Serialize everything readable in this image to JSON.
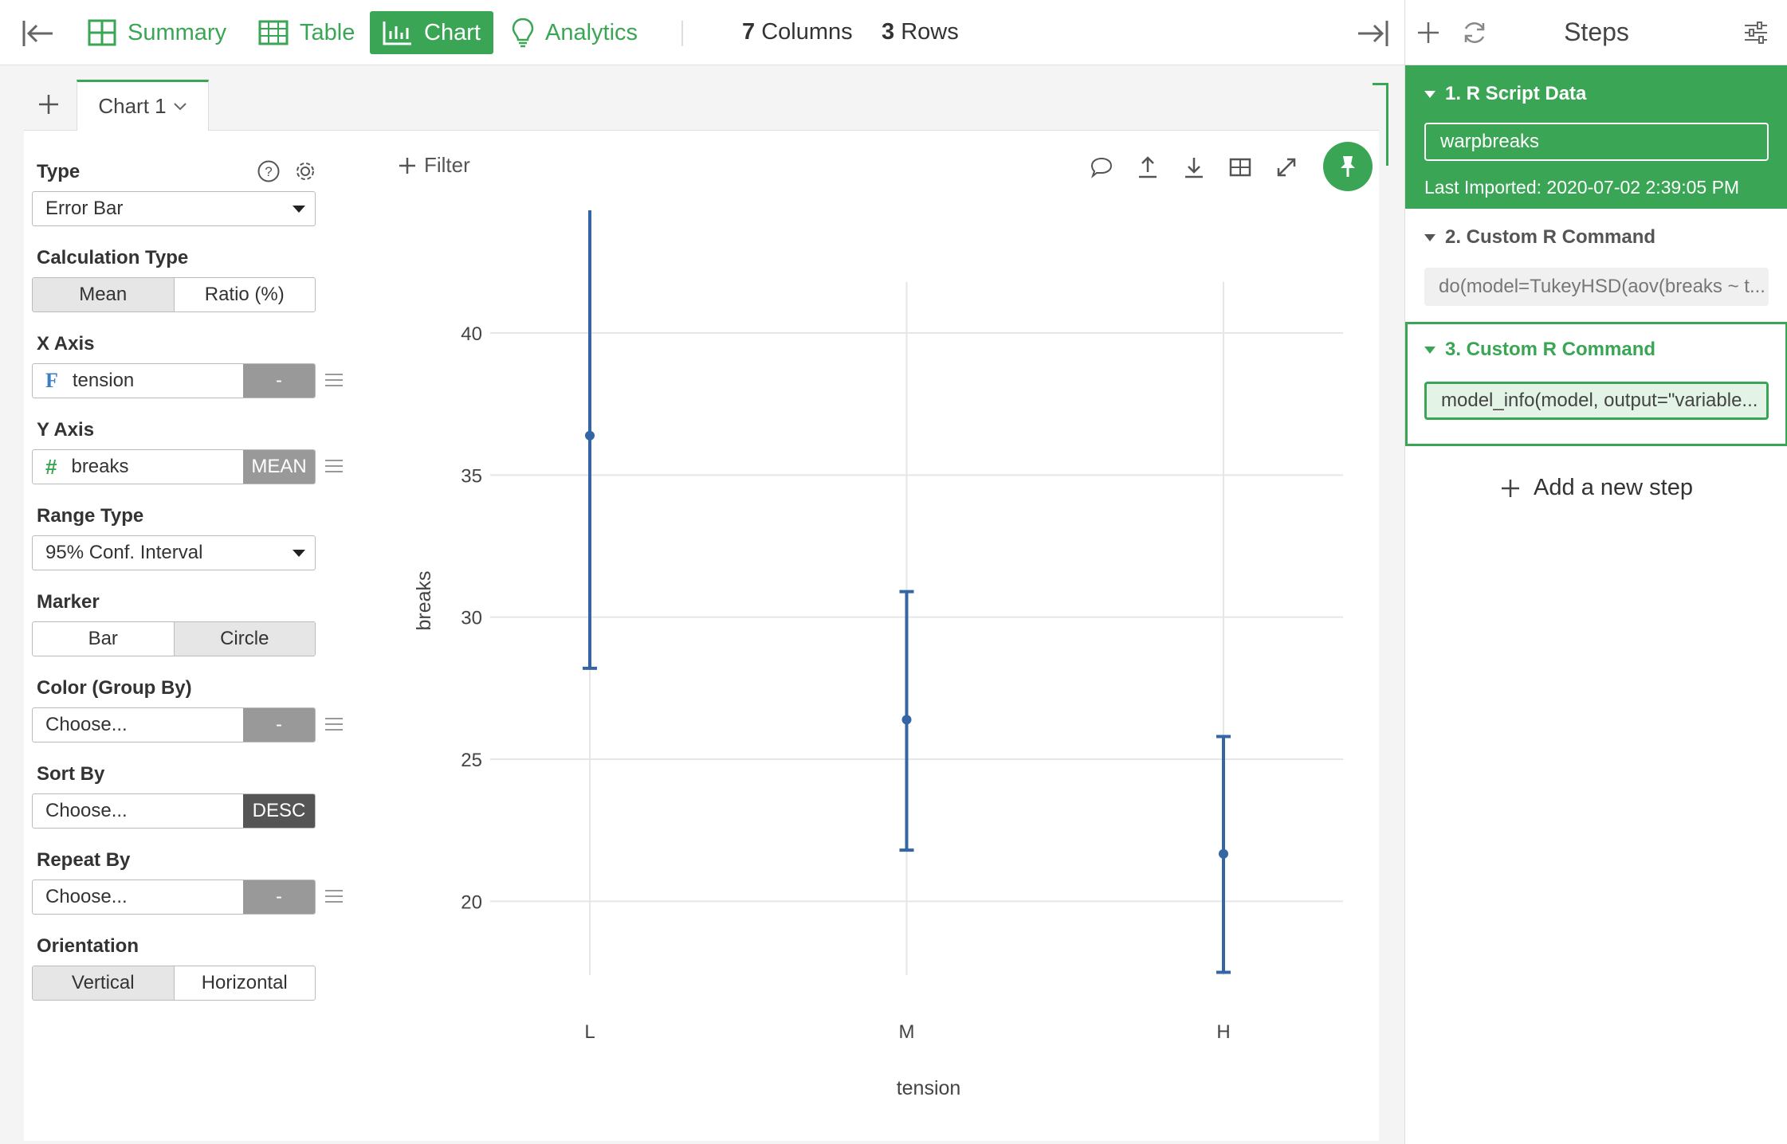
{
  "topbar": {
    "tabs": [
      {
        "label": "Summary"
      },
      {
        "label": "Table"
      },
      {
        "label": "Chart"
      },
      {
        "label": "Analytics"
      }
    ],
    "columns_count": "7",
    "columns_label": "Columns",
    "rows_count": "3",
    "rows_label": "Rows"
  },
  "chart_tab": {
    "label": "Chart 1"
  },
  "config": {
    "type_label": "Type",
    "type_value": "Error Bar",
    "calc_label": "Calculation Type",
    "calc_options": [
      "Mean",
      "Ratio (%)"
    ],
    "x_label": "X Axis",
    "x_field": "tension",
    "x_tag": "-",
    "y_label": "Y Axis",
    "y_field": "breaks",
    "y_tag": "MEAN",
    "range_label": "Range Type",
    "range_value": "95% Conf. Interval",
    "marker_label": "Marker",
    "marker_options": [
      "Bar",
      "Circle"
    ],
    "color_label": "Color (Group By)",
    "color_value": "Choose...",
    "color_tag": "-",
    "sort_label": "Sort By",
    "sort_value": "Choose...",
    "sort_tag": "DESC",
    "repeat_label": "Repeat By",
    "repeat_value": "Choose...",
    "repeat_tag": "-",
    "orient_label": "Orientation",
    "orient_options": [
      "Vertical",
      "Horizontal"
    ]
  },
  "toolbar": {
    "filter_label": "Filter"
  },
  "chart_data": {
    "type": "errorbar",
    "xlabel": "tension",
    "ylabel": "breaks",
    "categories": [
      "L",
      "M",
      "H"
    ],
    "mean": [
      36.39,
      26.39,
      21.67
    ],
    "lower": [
      28.2,
      21.8,
      17.5
    ],
    "upper": [
      44.6,
      30.9,
      25.8
    ],
    "ylim": [
      16,
      46
    ],
    "yticks": [
      20,
      25,
      30,
      35,
      40,
      45
    ],
    "color": "#3465a4",
    "grid": true
  },
  "steps": {
    "title": "Steps",
    "items": [
      {
        "title": "1. R Script Data",
        "value": "warpbreaks",
        "meta": "Last Imported: 2020-07-02 2:39:05 PM"
      },
      {
        "title": "2. Custom R Command",
        "value": "do(model=TukeyHSD(aov(breaks ~ t..."
      },
      {
        "title": "3. Custom R Command",
        "value": "model_info(model, output=\"variable..."
      }
    ],
    "add_label": "Add a new step"
  },
  "colors": {
    "accent": "#3aa655",
    "series": "#3465a4"
  }
}
